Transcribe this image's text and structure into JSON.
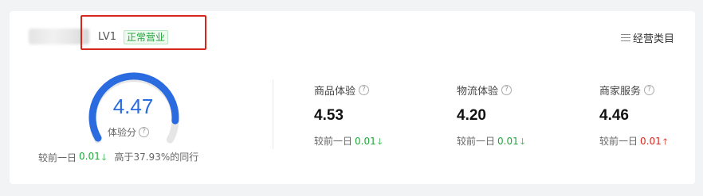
{
  "header": {
    "level": "LV1",
    "status": "正常营业",
    "category_link": "经营类目"
  },
  "overall": {
    "score": "4.47",
    "score_fraction": 0.894,
    "label": "体验分",
    "compare_prefix": "较前一日",
    "compare_value": "0.01",
    "compare_direction": "down",
    "peer_text": "高于37.93%的同行"
  },
  "metrics": [
    {
      "title": "商品体验",
      "value": "4.53",
      "compare_prefix": "较前一日",
      "compare_value": "0.01",
      "compare_direction": "down"
    },
    {
      "title": "物流体验",
      "value": "4.20",
      "compare_prefix": "较前一日",
      "compare_value": "0.01",
      "compare_direction": "down"
    },
    {
      "title": "商家服务",
      "value": "4.46",
      "compare_prefix": "较前一日",
      "compare_value": "0.01",
      "compare_direction": "up"
    }
  ],
  "icons": {
    "help": "help-circle-icon",
    "category": "list-icon",
    "down": "arrow-down-icon",
    "up": "arrow-up-icon"
  },
  "colors": {
    "accent": "#2a6be0",
    "gauge_track": "#e6e6e6",
    "positive": "#20a53a",
    "negative": "#d7261c",
    "highlight": "#d7261c"
  }
}
